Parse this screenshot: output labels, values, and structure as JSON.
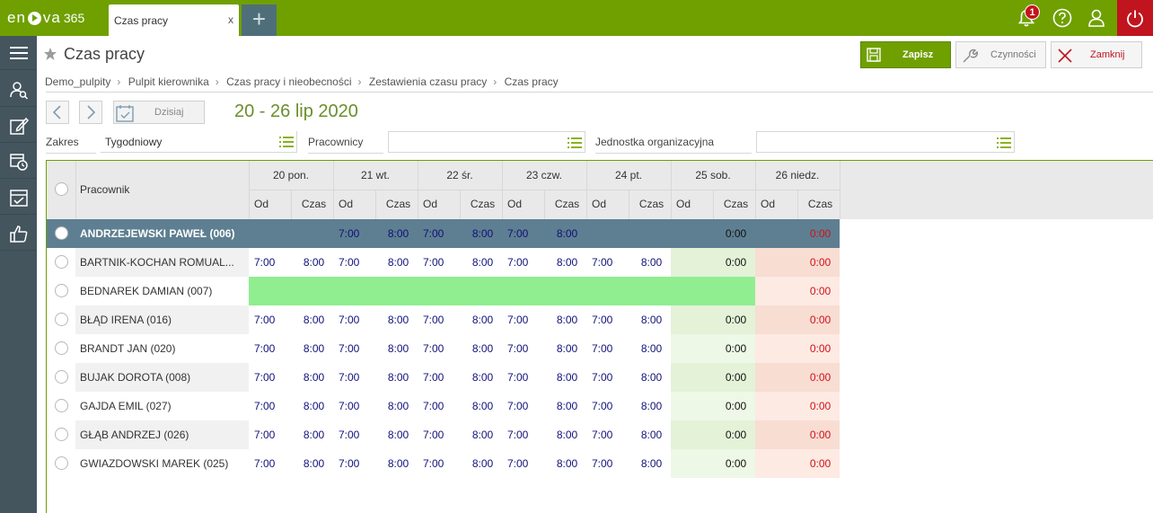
{
  "app": {
    "logo_text": "en",
    "logo_text2": "va",
    "logo_num": "365"
  },
  "tab": {
    "label": "Czas pracy",
    "close": "x"
  },
  "notifications": {
    "count": "1"
  },
  "page": {
    "title": "Czas pracy"
  },
  "toolbar": {
    "save_label": "Zapisz",
    "actions_label": "Czynności",
    "close_label": "Zamknij"
  },
  "breadcrumb": [
    "Demo_pulpity",
    "Pulpit kierownika",
    "Czas pracy i nieobecności",
    "Zestawienia czasu pracy",
    "Czas pracy"
  ],
  "nav": {
    "today_label": "Dzisiaj",
    "date_range": "20 - 26 lip 2020"
  },
  "filters": {
    "range_label": "Zakres",
    "range_value": "Tygodniowy",
    "employees_label": "Pracownicy",
    "employees_value": "",
    "unit_label": "Jednostka organizacyjna",
    "unit_value": ""
  },
  "grid": {
    "employee_header": "Pracownik",
    "days": [
      "20 pon.",
      "21 wt.",
      "22 śr.",
      "23 czw.",
      "24 pt.",
      "25 sob.",
      "26 niedz."
    ],
    "sub_from": "Od",
    "sub_time": "Czas",
    "rows": [
      {
        "name": "ANDRZEJEWSKI PAWEŁ (006)",
        "kind": "selected",
        "from": [
          "",
          "7:00",
          "7:00",
          "7:00",
          "",
          "",
          ""
        ],
        "time": [
          "",
          "8:00",
          "8:00",
          "8:00",
          "",
          "0:00",
          "0:00"
        ]
      },
      {
        "name": "BARTNIK-KOCHAN ROMUAL...",
        "kind": "normal",
        "from": [
          "7:00",
          "7:00",
          "7:00",
          "7:00",
          "7:00",
          "",
          ""
        ],
        "time": [
          "8:00",
          "8:00",
          "8:00",
          "8:00",
          "8:00",
          "0:00",
          "0:00"
        ]
      },
      {
        "name": "BEDNAREK DAMIAN (007)",
        "kind": "absence",
        "from": [
          "",
          "",
          "",
          "",
          "",
          "",
          ""
        ],
        "time": [
          "",
          "",
          "",
          "",
          "",
          "",
          "0:00"
        ]
      },
      {
        "name": "BŁĄD IRENA (016)",
        "kind": "normal",
        "from": [
          "7:00",
          "7:00",
          "7:00",
          "7:00",
          "7:00",
          "",
          ""
        ],
        "time": [
          "8:00",
          "8:00",
          "8:00",
          "8:00",
          "8:00",
          "0:00",
          "0:00"
        ]
      },
      {
        "name": "BRANDT JAN (020)",
        "kind": "normal",
        "from": [
          "7:00",
          "7:00",
          "7:00",
          "7:00",
          "7:00",
          "",
          ""
        ],
        "time": [
          "8:00",
          "8:00",
          "8:00",
          "8:00",
          "8:00",
          "0:00",
          "0:00"
        ]
      },
      {
        "name": "BUJAK DOROTA (008)",
        "kind": "normal",
        "from": [
          "7:00",
          "7:00",
          "7:00",
          "7:00",
          "7:00",
          "",
          ""
        ],
        "time": [
          "8:00",
          "8:00",
          "8:00",
          "8:00",
          "8:00",
          "0:00",
          "0:00"
        ]
      },
      {
        "name": "GAJDA EMIL (027)",
        "kind": "normal",
        "from": [
          "7:00",
          "7:00",
          "7:00",
          "7:00",
          "7:00",
          "",
          ""
        ],
        "time": [
          "8:00",
          "8:00",
          "8:00",
          "8:00",
          "8:00",
          "0:00",
          "0:00"
        ]
      },
      {
        "name": "GŁĄB ANDRZEJ (026)",
        "kind": "normal",
        "from": [
          "7:00",
          "7:00",
          "7:00",
          "7:00",
          "7:00",
          "",
          ""
        ],
        "time": [
          "8:00",
          "8:00",
          "8:00",
          "8:00",
          "8:00",
          "0:00",
          "0:00"
        ]
      },
      {
        "name": "GWIAZDOWSKI MAREK (025)",
        "kind": "normal",
        "from": [
          "7:00",
          "7:00",
          "7:00",
          "7:00",
          "7:00",
          "",
          ""
        ],
        "time": [
          "8:00",
          "8:00",
          "8:00",
          "8:00",
          "8:00",
          "0:00",
          "0:00"
        ]
      }
    ]
  },
  "colors": {
    "brand": "#6fa000",
    "selected_row": "#5e7f91",
    "absence": "#90ee90",
    "saturday_bg": "#eef8e6",
    "saturday_bg_alt": "#e4f2d8",
    "sunday_bg": "#fdeae3",
    "sunday_bg_alt": "#f8ddd3",
    "time_blue": "#10107a",
    "sunday_red": "#d0101a"
  },
  "icons": [
    "bell-icon",
    "help-icon",
    "user-icon",
    "power-icon",
    "menu-icon",
    "star-icon",
    "save-icon",
    "wrench-icon",
    "close-icon",
    "chevron-left-icon",
    "chevron-right-icon",
    "calendar-icon",
    "list-icon"
  ]
}
